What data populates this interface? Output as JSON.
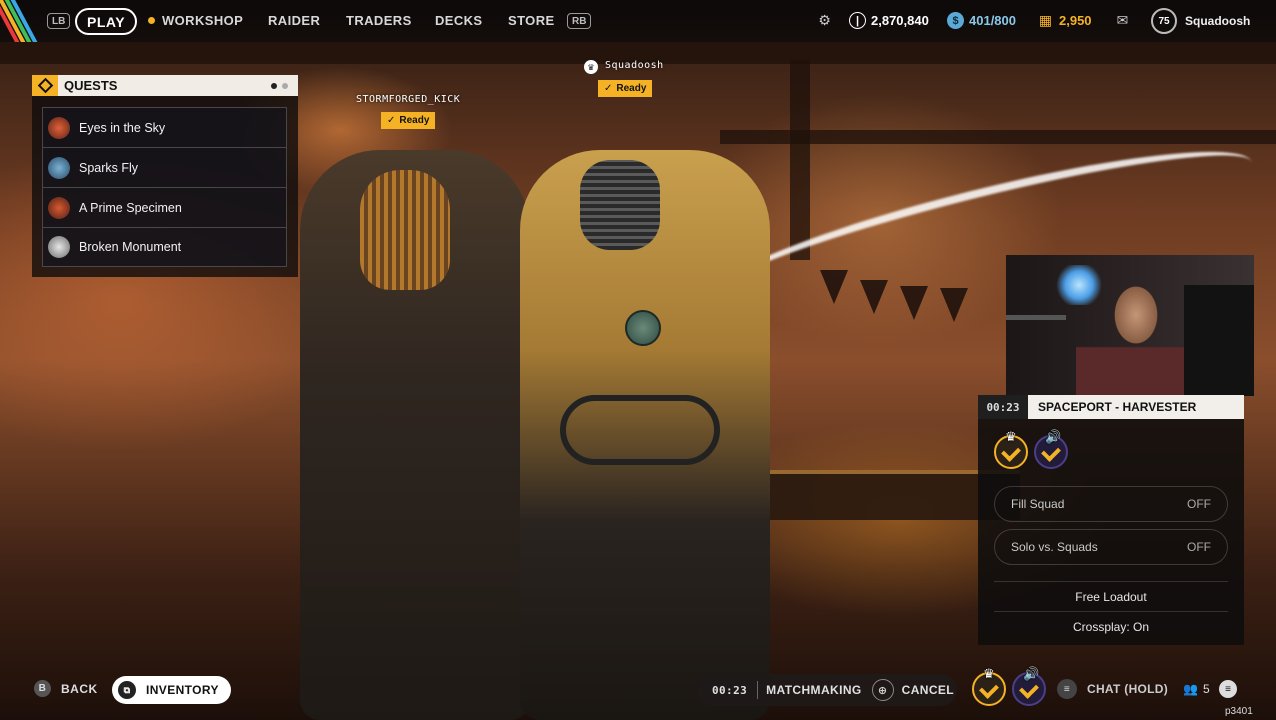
{
  "topbar": {
    "lb": "LB",
    "rb": "RB",
    "play": "PLAY",
    "nav": [
      "WORKSHOP",
      "RAIDER",
      "TRADERS",
      "DECKS",
      "STORE"
    ],
    "coins": "2,870,840",
    "capacity": "401/800",
    "tokens": "2,950",
    "level": "75",
    "username": "Squadoosh"
  },
  "quests": {
    "title": "QUESTS",
    "items": [
      {
        "label": "Eyes in the Sky",
        "icon": "red-robot-icon"
      },
      {
        "label": "Sparks Fly",
        "icon": "blue-robot-icon"
      },
      {
        "label": "A Prime Specimen",
        "icon": "red-robot-icon"
      },
      {
        "label": "Broken Monument",
        "icon": "statue-icon"
      }
    ]
  },
  "players": {
    "left": {
      "name": "STORMFORGED_KICK",
      "status": "Ready"
    },
    "right": {
      "name": "Squadoosh",
      "status": "Ready"
    }
  },
  "lobby": {
    "timer": "00:23",
    "map": "SPACEPORT - HARVESTER",
    "options": [
      {
        "label": "Fill Squad",
        "value": "OFF"
      },
      {
        "label": "Solo vs. Squads",
        "value": "OFF"
      }
    ],
    "loadout": "Free Loadout",
    "crossplay": "Crossplay: On"
  },
  "bottombar": {
    "back_key": "B",
    "back": "BACK",
    "inventory": "INVENTORY",
    "timer": "00:23",
    "matchmaking": "MATCHMAKING",
    "cancel": "CANCEL",
    "chat": "CHAT (HOLD)",
    "party_count": "5",
    "watermark": "p3401"
  },
  "colors": {
    "accent": "#f5b225",
    "panel": "#0e0c0c",
    "squad_purple": "#4b3f8a"
  }
}
